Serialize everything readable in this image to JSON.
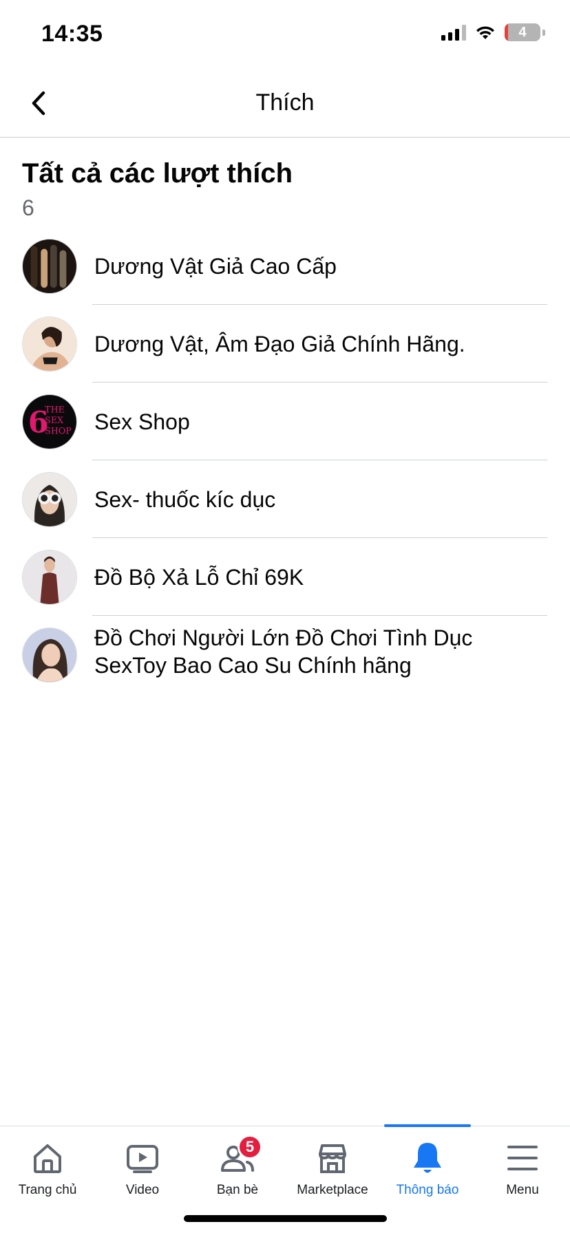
{
  "status_bar": {
    "time": "14:35",
    "battery": "4"
  },
  "header": {
    "title": "Thích",
    "back_icon": "chevron-left-icon"
  },
  "likes": {
    "section_title": "Tất cả các lượt thích",
    "count": "6",
    "items": [
      {
        "name": "Dương Vật Giả Cao Cấp"
      },
      {
        "name": "Dương Vật, Âm Đạo Giả Chính Hãng."
      },
      {
        "name": "Sex Shop",
        "avatar_text": [
          "THE",
          "SEX",
          "SHOP"
        ],
        "avatar_numeral": "6"
      },
      {
        "name": "Sex- thuốc kíc dục"
      },
      {
        "name": "Đồ Bộ Xả Lỗ Chỉ 69K"
      },
      {
        "name": "Đồ Chơi Người Lớn Đồ Chơi Tình Dục SexToy Bao Cao Su Chính hãng"
      }
    ]
  },
  "tab_bar": {
    "tabs": [
      {
        "label": "Trang chủ",
        "icon": "home-icon"
      },
      {
        "label": "Video",
        "icon": "video-icon"
      },
      {
        "label": "Bạn bè",
        "icon": "friends-icon",
        "badge": "5"
      },
      {
        "label": "Marketplace",
        "icon": "marketplace-icon"
      },
      {
        "label": "Thông báo",
        "icon": "bell-icon",
        "active": true
      },
      {
        "label": "Menu",
        "icon": "menu-icon"
      }
    ],
    "active_color": "#1877f2",
    "badge_color": "#e41e3f"
  }
}
